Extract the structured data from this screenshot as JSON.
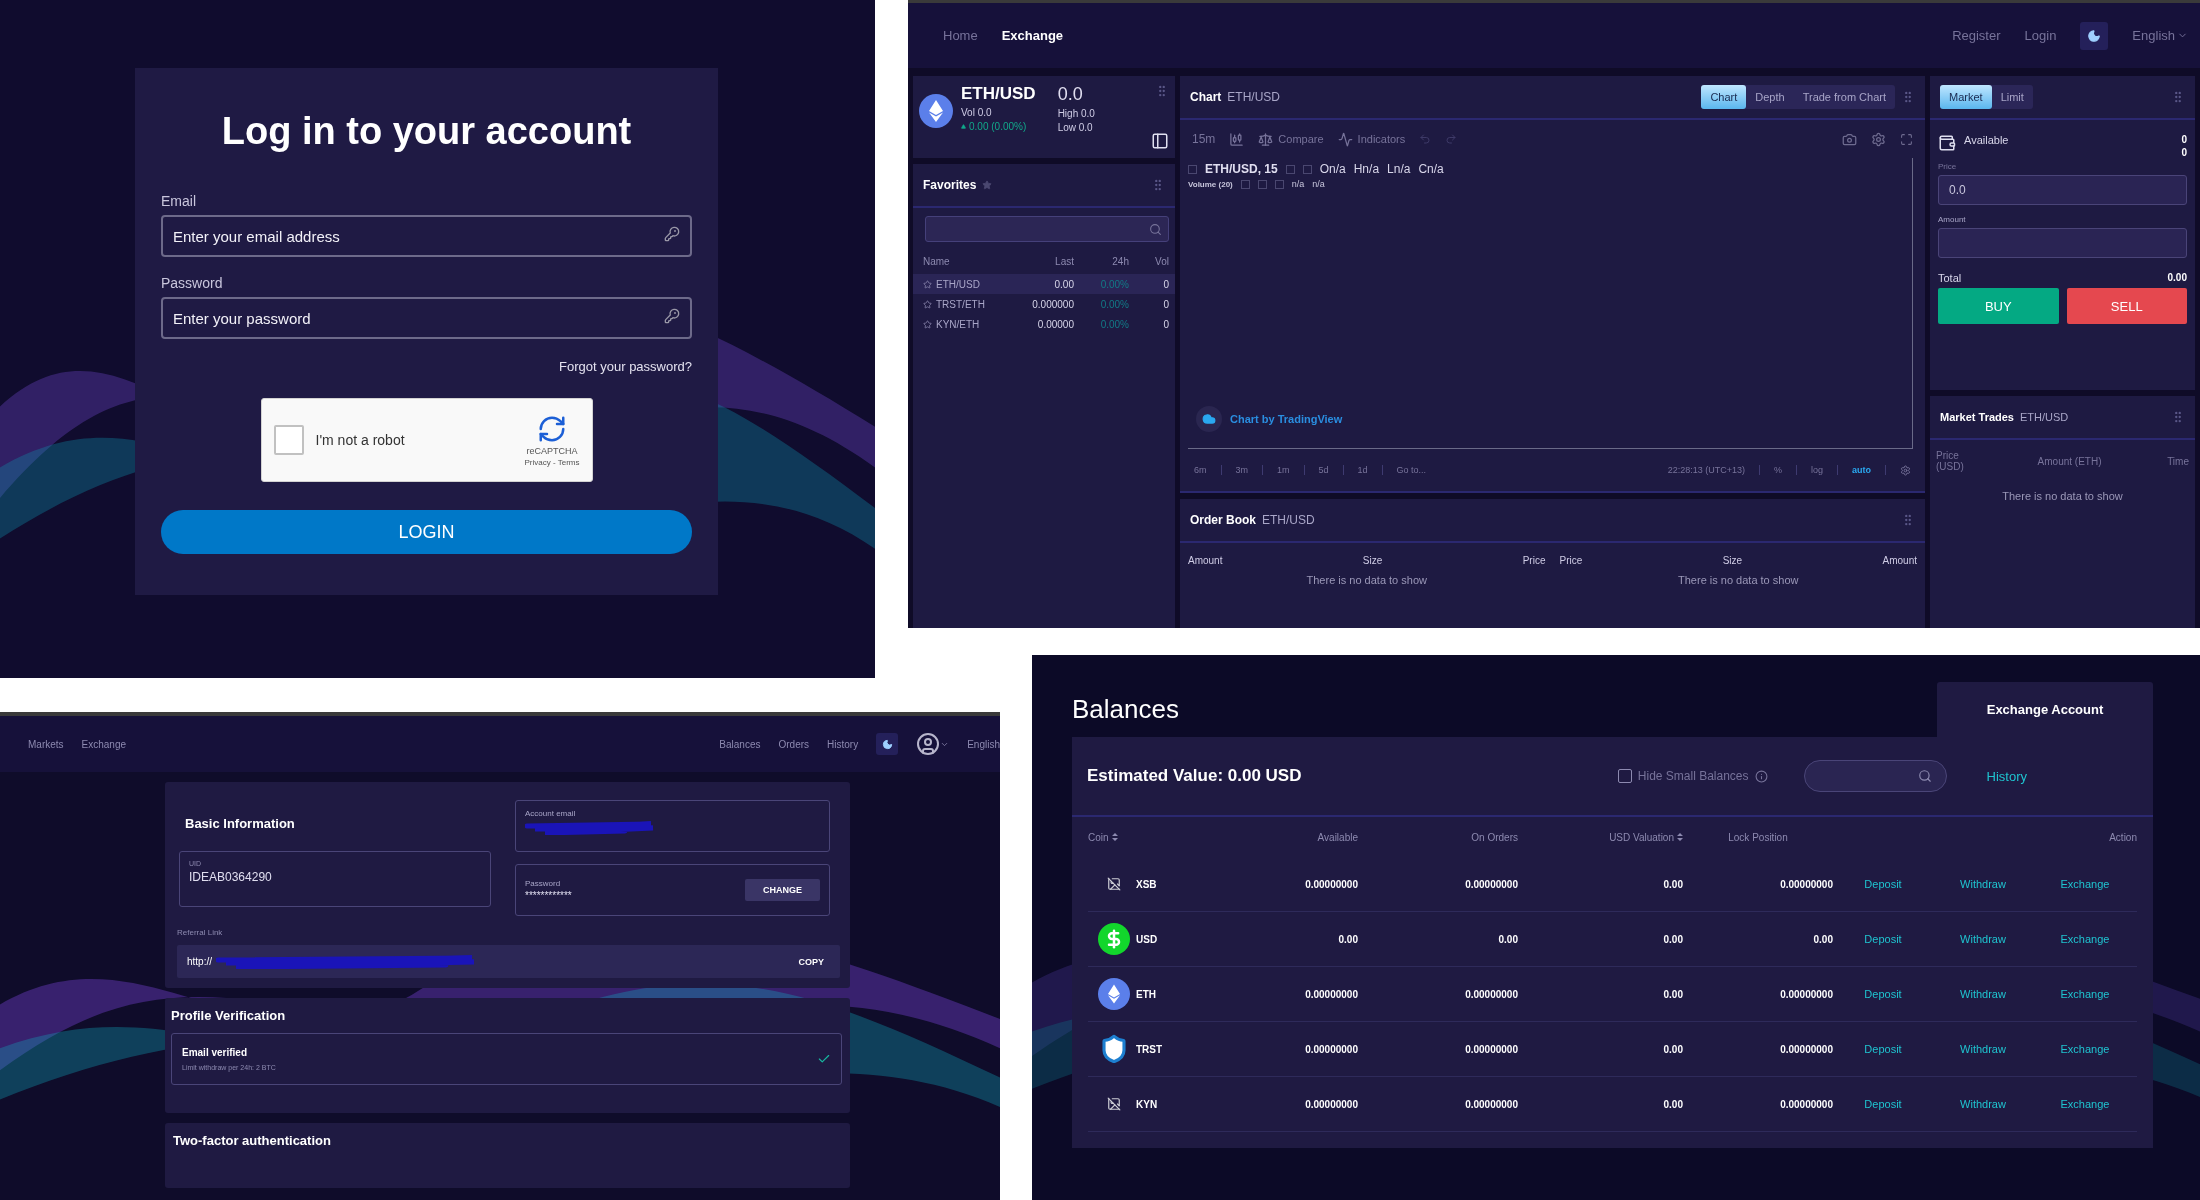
{
  "login": {
    "title": "Log in to your account",
    "email_label": "Email",
    "email_placeholder": "Enter your email address",
    "password_label": "Password",
    "password_placeholder": "Enter your password",
    "forgot_link": "Forgot your password?",
    "captcha": {
      "label": "I'm not a robot",
      "checked": false,
      "brand": "reCAPTCHA",
      "links": "Privacy - Terms"
    },
    "submit": "LOGIN"
  },
  "exchange": {
    "nav": [
      {
        "label": "Home",
        "selected": false
      },
      {
        "label": "Exchange",
        "selected": true
      }
    ],
    "account_links": [
      "Register",
      "Login"
    ],
    "language": "English",
    "ticker": {
      "pair": "ETH/USD",
      "price": "0.0",
      "volume": "Vol 0.0",
      "change": "0.00 (0.00%)",
      "high": "High 0.0",
      "low": "Low 0.0"
    },
    "favorites": {
      "title": "Favorites",
      "columns": [
        "Name",
        "Last",
        "24h",
        "Vol"
      ],
      "rows": [
        {
          "pair": "ETH/USD",
          "last": "0.00",
          "change": "0.00%",
          "volume": "0",
          "selected": true
        },
        {
          "pair": "TRST/ETH",
          "last": "0.000000",
          "change": "0.00%",
          "volume": "0",
          "selected": false
        },
        {
          "pair": "KYN/ETH",
          "last": "0.00000",
          "change": "0.00%",
          "volume": "0",
          "selected": false
        }
      ]
    },
    "chart": {
      "title": "Chart",
      "pair": "ETH/USD",
      "tabs": [
        {
          "label": "Chart",
          "selected": true
        },
        {
          "label": "Depth",
          "selected": false
        },
        {
          "label": "Trade from Chart",
          "selected": false
        }
      ],
      "interval": "15m",
      "tools": [
        "Compare",
        "Indicators"
      ],
      "symbol": "ETH/USD, 15",
      "ohlc": [
        "On/a",
        "Hn/a",
        "Ln/a",
        "Cn/a"
      ],
      "volume_label": "Volume (20)",
      "volume_values": [
        "n/a",
        "n/a"
      ],
      "attribution": "Chart by TradingView",
      "ranges": [
        "6m",
        "3m",
        "1m",
        "5d",
        "1d",
        "Go to..."
      ],
      "time": "22:28:13 (UTC+13)",
      "scale_options": [
        {
          "label": "%",
          "selected": false
        },
        {
          "label": "log",
          "selected": false
        },
        {
          "label": "auto",
          "selected": true
        }
      ]
    },
    "order_book": {
      "title": "Order Book",
      "pair": "ETH/USD",
      "sides": [
        {
          "columns": [
            "Amount",
            "Size",
            "Price"
          ],
          "empty": "There is no data to show"
        },
        {
          "columns": [
            "Price",
            "Size",
            "Amount"
          ],
          "empty": "There is no data to show"
        }
      ]
    },
    "order_form": {
      "tabs": [
        {
          "label": "Market",
          "selected": true
        },
        {
          "label": "Limit",
          "selected": false
        }
      ],
      "available_label": "Available",
      "available_values": [
        "0",
        "0"
      ],
      "price_label": "Price",
      "price_value": "0.0",
      "amount_label": "Amount",
      "total_label": "Total",
      "total_value": "0.00",
      "buy": "BUY",
      "sell": "SELL"
    },
    "market_trades": {
      "title": "Market Trades",
      "pair": "ETH/USD",
      "columns": [
        "Price (USD)",
        "Amount (ETH)",
        "Time"
      ],
      "empty": "There is no data to show"
    }
  },
  "profile": {
    "nav_left": [
      "Markets",
      "Exchange"
    ],
    "nav_right": [
      "Balances",
      "Orders",
      "History"
    ],
    "language": "English",
    "basic_info": {
      "title": "Basic Information",
      "uid_label": "UID",
      "uid": "IDEAB0364290",
      "email_label": "Account email",
      "password_label": "Password",
      "password": "************",
      "change": "CHANGE",
      "referral_label": "Referral Link",
      "referral": "http://",
      "copy": "COPY"
    },
    "verification": {
      "title": "Profile Verification",
      "items": [
        {
          "title": "Email verified",
          "detail": "Limit withdraw per 24h: 2 BTC",
          "verified": true
        }
      ]
    },
    "two_factor": {
      "title": "Two-factor authentication"
    }
  },
  "balances": {
    "title": "Balances",
    "account_tab": "Exchange Account",
    "estimated": "Estimated Value: 0.00 USD",
    "hide_small": {
      "label": "Hide Small Balances",
      "checked": false
    },
    "history_link": "History",
    "columns": [
      {
        "label": "Coin",
        "sortable": true
      },
      {
        "label": "Available",
        "sortable": false
      },
      {
        "label": "On Orders",
        "sortable": false
      },
      {
        "label": "USD Valuation",
        "sortable": true
      },
      {
        "label": "Lock Position",
        "sortable": false
      },
      {
        "label": "Action",
        "sortable": false
      }
    ],
    "rows": [
      {
        "coin": "XSB",
        "kind": "broken",
        "available": "0.00000000",
        "on_orders": "0.00000000",
        "usd": "0.00",
        "lock": "0.00000000",
        "actions": [
          "Deposit",
          "Withdraw",
          "Exchange"
        ]
      },
      {
        "coin": "USD",
        "kind": "dollar",
        "available": "0.00",
        "on_orders": "0.00",
        "usd": "0.00",
        "lock": "0.00",
        "actions": [
          "Deposit",
          "Withdraw",
          "Exchange"
        ]
      },
      {
        "coin": "ETH",
        "kind": "eth",
        "available": "0.00000000",
        "on_orders": "0.00000000",
        "usd": "0.00",
        "lock": "0.00000000",
        "actions": [
          "Deposit",
          "Withdraw",
          "Exchange"
        ]
      },
      {
        "coin": "TRST",
        "kind": "shield",
        "available": "0.00000000",
        "on_orders": "0.00000000",
        "usd": "0.00",
        "lock": "0.00000000",
        "actions": [
          "Deposit",
          "Withdraw",
          "Exchange"
        ]
      },
      {
        "coin": "KYN",
        "kind": "broken",
        "available": "0.00000000",
        "on_orders": "0.00000000",
        "usd": "0.00",
        "lock": "0.00000000",
        "actions": [
          "Deposit",
          "Withdraw",
          "Exchange"
        ]
      }
    ]
  }
}
